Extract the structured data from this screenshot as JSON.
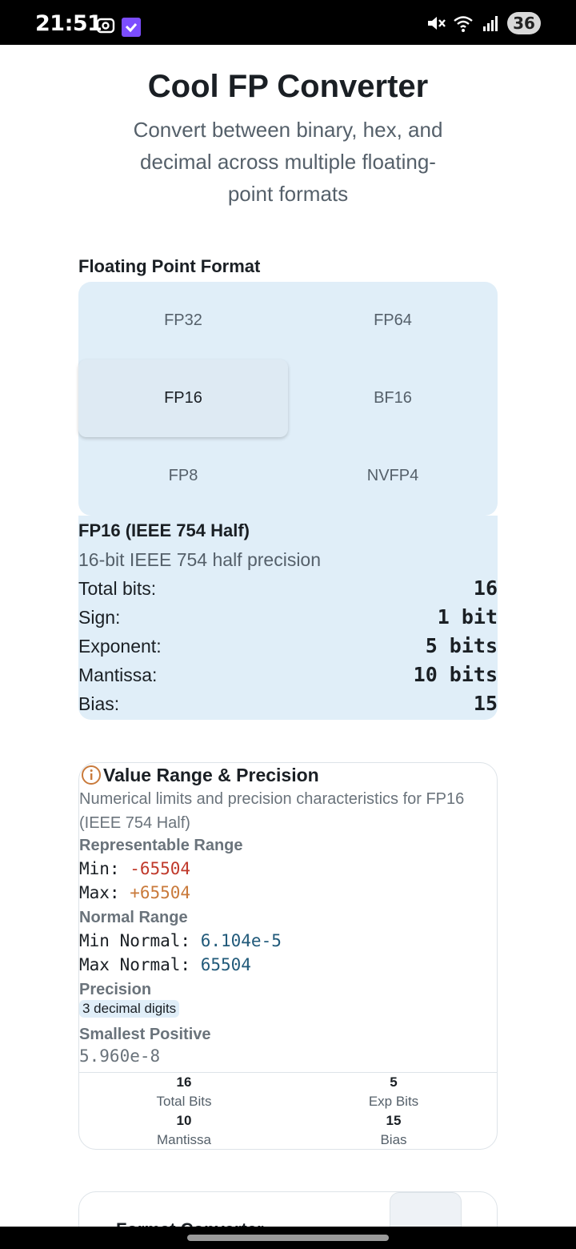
{
  "status_bar": {
    "time": "21:51",
    "battery": "36"
  },
  "header": {
    "title": "Cool FP Converter",
    "subtitle": "Convert between binary, hex, and decimal across multiple floating-point formats"
  },
  "format_section": {
    "label": "Floating Point Format",
    "options": [
      "FP32",
      "FP64",
      "FP16",
      "BF16",
      "FP8",
      "NVFP4"
    ],
    "selected": "FP16"
  },
  "format_info": {
    "title": "FP16 (IEEE 754 Half)",
    "description": "16-bit IEEE 754 half precision",
    "rows": [
      {
        "label": "Total bits:",
        "value": "16"
      },
      {
        "label": "Sign:",
        "value": "1 bit"
      },
      {
        "label": "Exponent:",
        "value": "5 bits"
      },
      {
        "label": "Mantissa:",
        "value": "10 bits"
      },
      {
        "label": "Bias:",
        "value": "15"
      }
    ]
  },
  "range_card": {
    "title": "Value Range & Precision",
    "description": "Numerical limits and precision characteristics for FP16 (IEEE 754 Half)",
    "representable_label": "Representable Range",
    "min_label": "Min: ",
    "min_value": "-65504",
    "max_label": "Max: ",
    "max_value": "+65504",
    "normal_label": "Normal Range",
    "min_normal_label": "Min Normal: ",
    "min_normal_value": "6.104e-5",
    "max_normal_label": "Max Normal: ",
    "max_normal_value": "65504",
    "precision_label": "Precision",
    "precision_value": "3 decimal digits",
    "smallest_label": "Smallest Positive",
    "smallest_value": "5.960e-8",
    "stats": [
      {
        "value": "16",
        "label": "Total Bits"
      },
      {
        "value": "5",
        "label": "Exp Bits"
      },
      {
        "value": "10",
        "label": "Mantissa"
      },
      {
        "value": "15",
        "label": "Bias"
      }
    ]
  },
  "next_card": {
    "title": "Format Converter"
  },
  "colors": {
    "accent_bg": "#e0eef8",
    "negative": "#c0392b",
    "positive": "#c97a3b",
    "number": "#215a7a"
  }
}
